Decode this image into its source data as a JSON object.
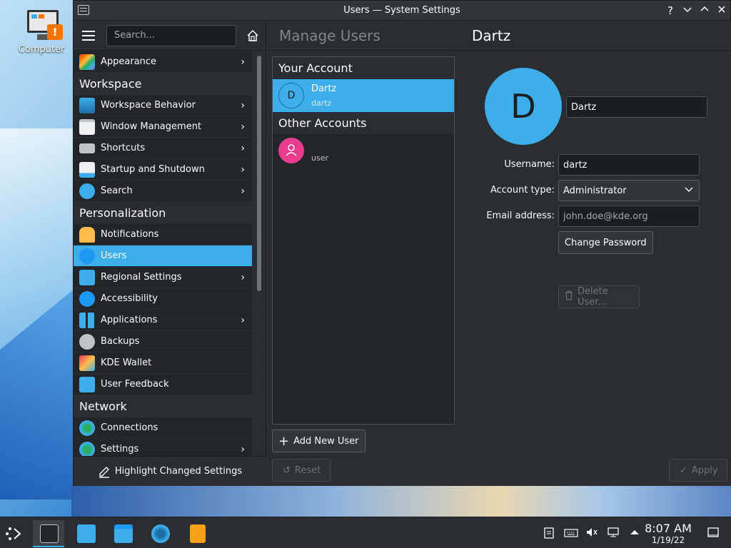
{
  "desktop": {
    "icon_label": "Computer"
  },
  "window": {
    "title": "Users — System Settings"
  },
  "sidebar": {
    "search_placeholder": "Search...",
    "top_item": {
      "label": "Appearance"
    },
    "categories": {
      "workspace": "Workspace",
      "personalization": "Personalization",
      "network": "Network"
    },
    "workspace_items": [
      {
        "label": "Workspace Behavior"
      },
      {
        "label": "Window Management"
      },
      {
        "label": "Shortcuts"
      },
      {
        "label": "Startup and Shutdown"
      },
      {
        "label": "Search"
      }
    ],
    "personalization_items": [
      {
        "label": "Notifications"
      },
      {
        "label": "Users"
      },
      {
        "label": "Regional Settings"
      },
      {
        "label": "Accessibility"
      },
      {
        "label": "Applications"
      },
      {
        "label": "Backups"
      },
      {
        "label": "KDE Wallet"
      },
      {
        "label": "User Feedback"
      }
    ],
    "network_items": [
      {
        "label": "Connections"
      },
      {
        "label": "Settings"
      }
    ],
    "footer_label": "Highlight Changed Settings"
  },
  "page": {
    "breadcrumb": "Manage Users",
    "title": "Dartz",
    "your_account_header": "Your Account",
    "other_accounts_header": "Other Accounts",
    "accounts": [
      {
        "initial": "D",
        "name": "Dartz",
        "username": "dartz"
      },
      {
        "initial": "",
        "name": "",
        "username": "user"
      }
    ],
    "add_user_label": "Add New User",
    "reset_label": "Reset",
    "apply_label": "Apply"
  },
  "details": {
    "avatar_initial": "D",
    "full_name": "Dartz",
    "username_label": "Username:",
    "username_value": "dartz",
    "account_type_label": "Account type:",
    "account_type_value": "Administrator",
    "email_label": "Email address:",
    "email_placeholder": "john.doe@kde.org",
    "change_password_label": "Change Password",
    "delete_user_label": "Delete User..."
  },
  "taskbar": {
    "time": "8:07 AM",
    "date": "1/19/22"
  },
  "colors": {
    "accent": "#3daee9",
    "window_bg": "#2a2e32",
    "view_bg": "#232629",
    "other_user_avatar": "#e93d8f"
  }
}
